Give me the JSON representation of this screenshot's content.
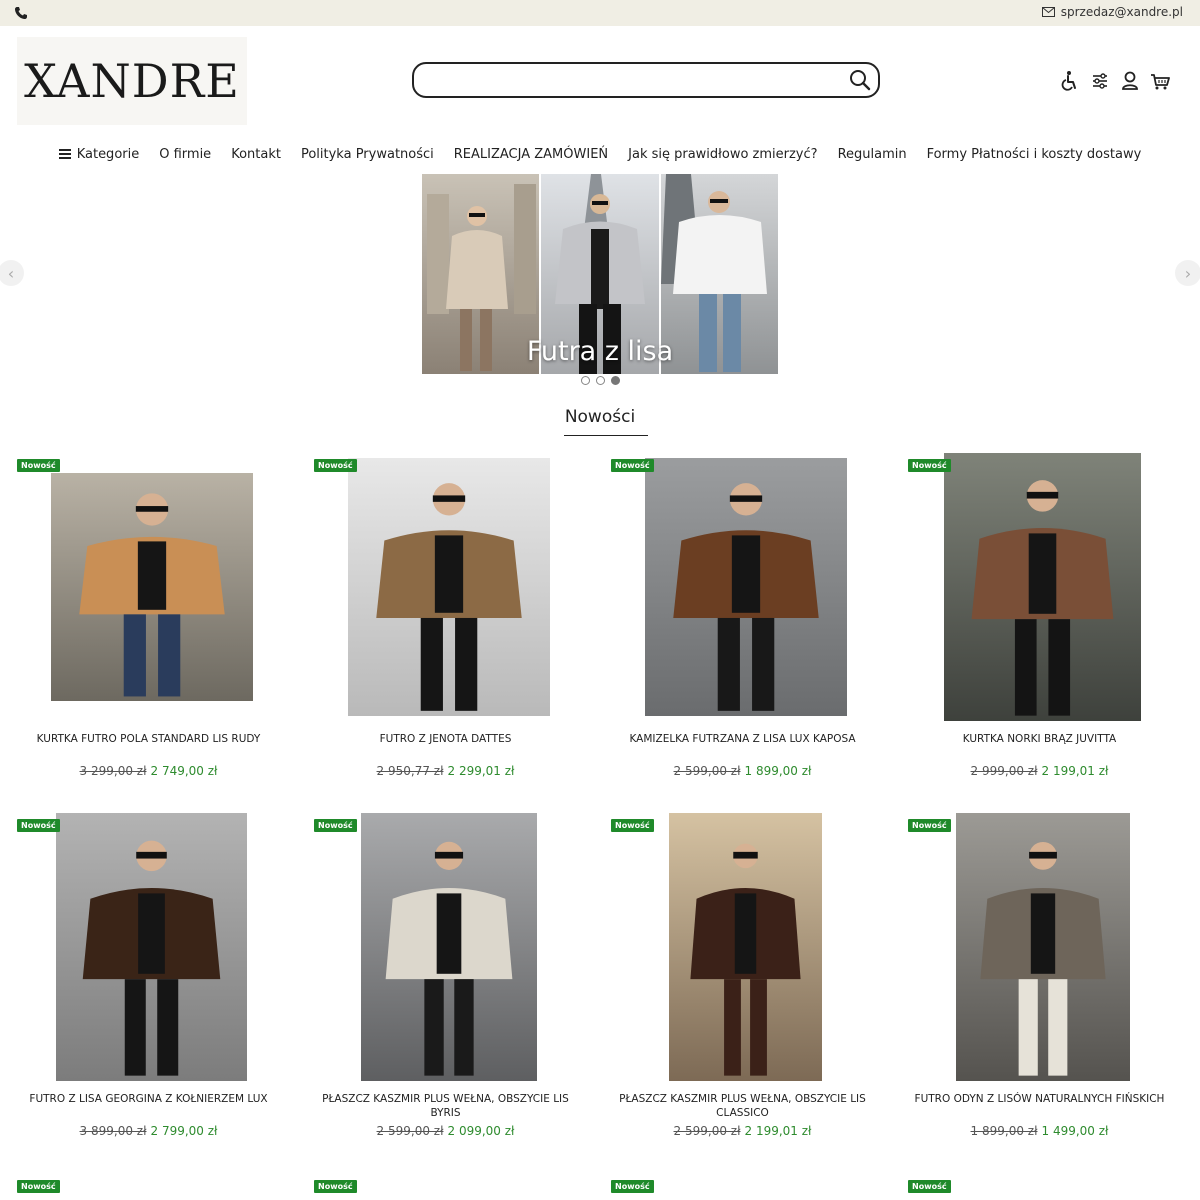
{
  "topbar": {
    "phone_icon": "phone-icon",
    "email": "sprzedaz@xandre.pl",
    "email_icon": "envelope-icon"
  },
  "logo": {
    "text": "XANDRE"
  },
  "search": {
    "placeholder": "",
    "value": "",
    "icon": "search-icon"
  },
  "header_icons": [
    "accessibility-icon",
    "filters-icon",
    "user-icon",
    "cart-icon"
  ],
  "nav": {
    "items": [
      "Kategorie",
      "O firmie",
      "Kontakt",
      "Polityka Prywatności",
      "REALIZACJA ZAMÓWIEŃ",
      "Jak się prawidłowo zmierzyć?",
      "Regulamin",
      "Formy Płatności i koszty dostawy"
    ]
  },
  "slider": {
    "caption": "Futra z lisa",
    "slides": 3,
    "active_slide": 3,
    "prev_icon": "chevron-left-icon",
    "next_icon": "chevron-right-icon"
  },
  "section": {
    "title": "Nowości"
  },
  "badge_label": "Nowość",
  "products": [
    {
      "name": "KURTKA FUTRO POLA STANDARD LIS RUDY",
      "old_price": "3 299,00 zł",
      "price": "2 749,00 zł"
    },
    {
      "name": "FUTRO Z JENOTA DATTES",
      "old_price": "2 950,77 zł",
      "price": "2 299,01 zł"
    },
    {
      "name": "KAMIZELKA FUTRZANA Z LISA LUX KAPOSA",
      "old_price": "2 599,00 zł",
      "price": "1 899,00 zł"
    },
    {
      "name": "KURTKA NORKI BRĄZ JUVITTA",
      "old_price": "2 999,00 zł",
      "price": "2 199,01 zł"
    },
    {
      "name": "FUTRO Z LISA GEORGINA Z KOŁNIERZEM LUX",
      "old_price": "3 899,00 zł",
      "price": "2 799,00 zł"
    },
    {
      "name": "PŁASZCZ KASZMIR PLUS WEŁNA, OBSZYCIE LIS BYRIS",
      "old_price": "2 599,00 zł",
      "price": "2 099,00 zł"
    },
    {
      "name": "PŁASZCZ KASZMIR PLUS WEŁNA, OBSZYCIE LIS CLASSICO",
      "old_price": "2 599,00 zł",
      "price": "2 199,01 zł"
    },
    {
      "name": "FUTRO ODYN Z LISÓW NATURALNYCH FIŃSKICH",
      "old_price": "1 899,00 zł",
      "price": "1 499,00 zł"
    }
  ],
  "colors": {
    "topbar_bg": "#f0eee4",
    "badge_bg": "#1f8a2a",
    "sale_price": "#2e8b2e"
  }
}
